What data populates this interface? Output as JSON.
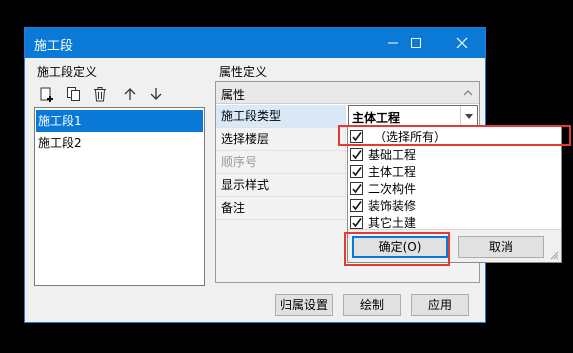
{
  "window": {
    "title": "施工段",
    "controls": {
      "minimize": "minimize-icon",
      "maximize": "maximize-icon",
      "close": "close-icon"
    }
  },
  "left": {
    "section_label": "施工段定义",
    "toolbar": [
      "add-icon",
      "copy-icon",
      "delete-icon",
      "arrow-up-icon",
      "arrow-down-icon"
    ],
    "items": [
      {
        "label": "施工段1",
        "selected": true
      },
      {
        "label": "施工段2",
        "selected": false
      }
    ]
  },
  "right": {
    "section_label": "属性定义",
    "grid": {
      "header": "属性",
      "rows": [
        {
          "key": "施工段类型",
          "value": "主体工程",
          "disabled": false
        },
        {
          "key": "选择楼层",
          "value": "",
          "disabled": false
        },
        {
          "key": "顺序号",
          "value": "",
          "disabled": true
        },
        {
          "key": "显示样式",
          "value": "",
          "disabled": false
        },
        {
          "key": "备注",
          "value": "",
          "disabled": false
        }
      ]
    }
  },
  "dropdown": {
    "options": [
      {
        "label": "（选择所有）",
        "checked": true
      },
      {
        "label": "基础工程",
        "checked": true
      },
      {
        "label": "主体工程",
        "checked": true
      },
      {
        "label": "二次构件",
        "checked": true
      },
      {
        "label": "装饰装修",
        "checked": true
      },
      {
        "label": "其它土建",
        "checked": true
      }
    ],
    "ok_label": "确定(O)",
    "cancel_label": "取消"
  },
  "buttons": {
    "assign": "归属设置",
    "draw": "绘制",
    "apply": "应用"
  },
  "colors": {
    "titlebar": "#0a7ad6",
    "selection": "#0a78d7",
    "highlight": "#e53935"
  }
}
